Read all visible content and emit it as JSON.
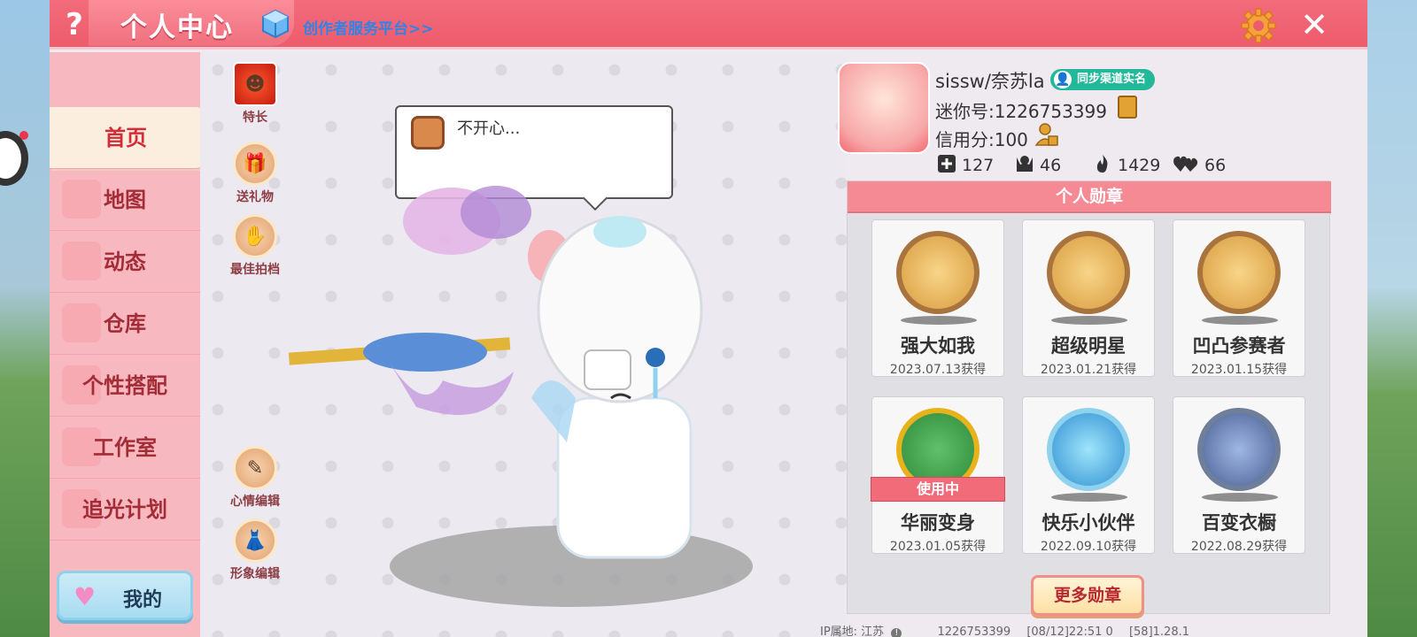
{
  "header": {
    "help_glyph": "?",
    "title": "个人中心",
    "creator_link": "创作者服务平台>>",
    "close_glyph": "✕"
  },
  "sidebar": {
    "items": [
      {
        "label": "首页",
        "active": true
      },
      {
        "label": "地图",
        "active": false
      },
      {
        "label": "动态",
        "active": false
      },
      {
        "label": "仓库",
        "active": false
      },
      {
        "label": "个性搭配",
        "active": false
      },
      {
        "label": "工作室",
        "active": false
      },
      {
        "label": "追光计划",
        "active": false
      }
    ],
    "mine_button": "我的"
  },
  "actions": {
    "specialty": "特长",
    "send_gift": "送礼物",
    "best_partner": "最佳拍档",
    "mood_edit": "心情编辑",
    "look_edit": "形象编辑"
  },
  "mood": {
    "text": "不开心..."
  },
  "profile": {
    "username": "sissw/奈苏la",
    "sync_badge": "同步渠道实名",
    "mini_id": "迷你号:1226753399",
    "credit": "信用分:100",
    "stats": {
      "followers": "127",
      "likes": "46",
      "popularity": "1429",
      "hearts": "66"
    }
  },
  "medals": {
    "header": "个人勋章",
    "in_use_label": "使用中",
    "items": [
      {
        "name": "强大如我",
        "date": "2023.07.13获得"
      },
      {
        "name": "超级明星",
        "date": "2023.01.21获得"
      },
      {
        "name": "凹凸参赛者",
        "date": "2023.01.15获得"
      },
      {
        "name": "华丽变身",
        "date": "2023.01.05获得"
      },
      {
        "name": "快乐小伙伴",
        "date": "2022.09.10获得"
      },
      {
        "name": "百变衣橱",
        "date": "2022.08.29获得"
      }
    ],
    "more_button": "更多勋章"
  },
  "footer": {
    "ip_location": "IP属地: 江苏",
    "uid": "1226753399",
    "timestamp": "[08/12]22:51 0",
    "version": "[58]1.28.1"
  },
  "colors": {
    "accent": "#ee5b6d",
    "sidebar": "#f8b8bf",
    "link": "#2f84e8",
    "badge": "#22b899"
  }
}
